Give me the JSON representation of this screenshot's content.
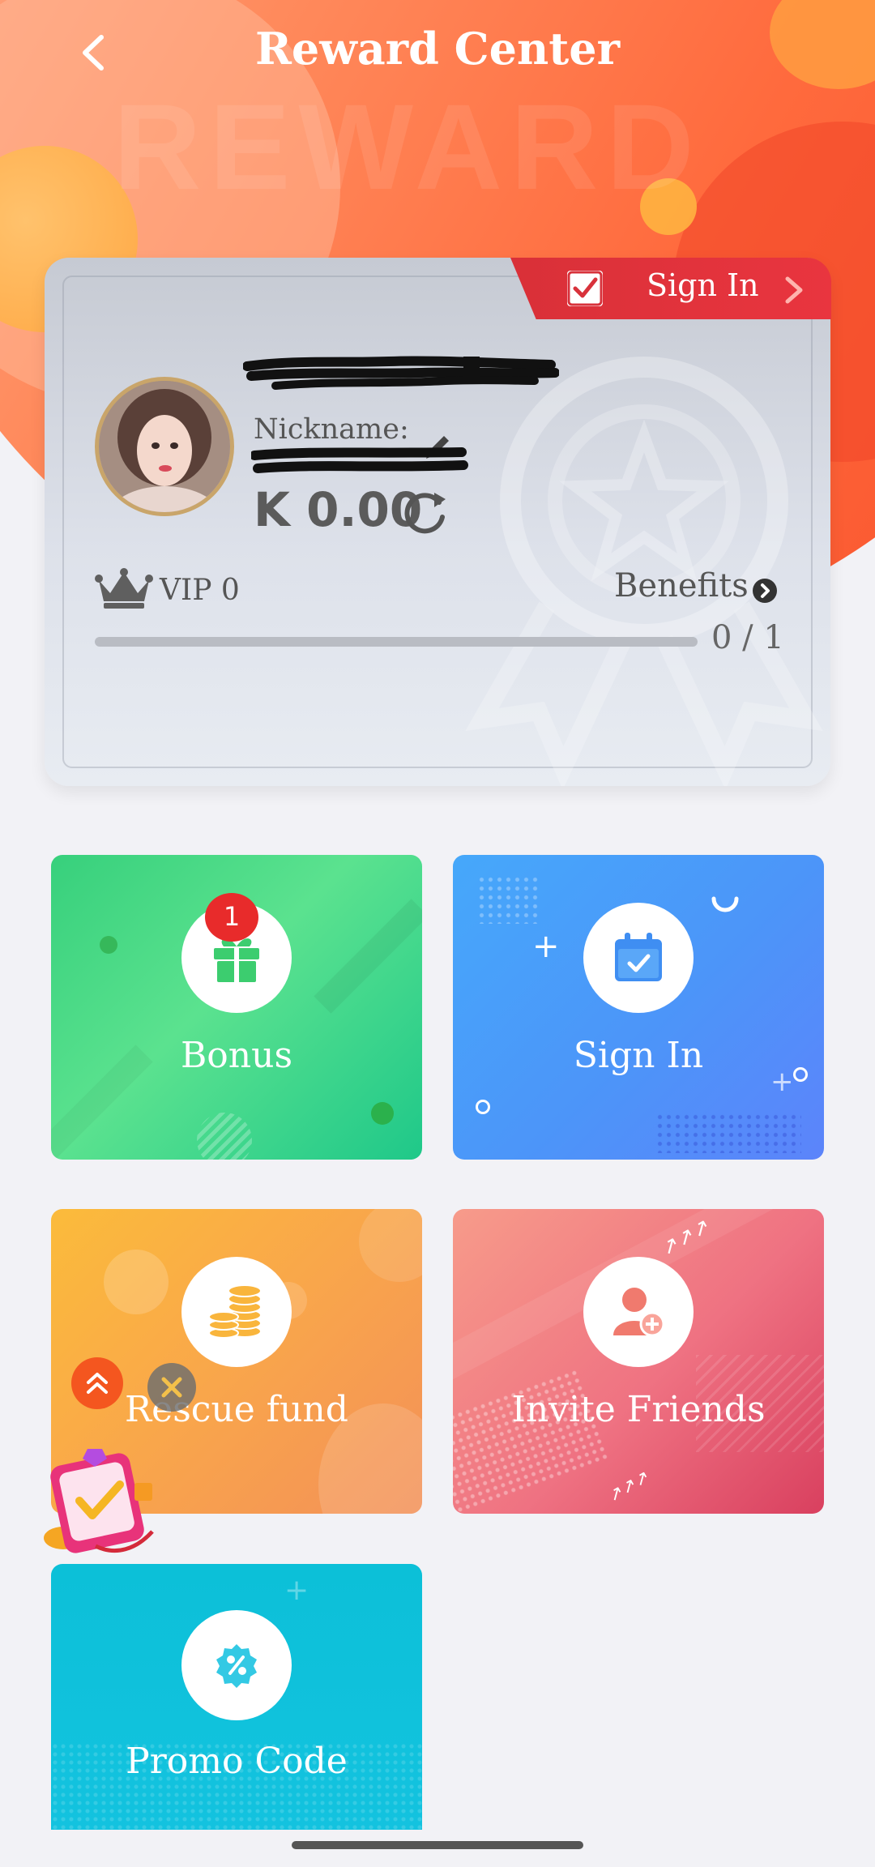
{
  "header": {
    "title": "Reward Center",
    "back_icon": "chevron-left-icon"
  },
  "profile": {
    "signin_tab_label": "Sign In",
    "nickname_label": "Nickname:",
    "balance": "K 0.00",
    "vip_label": "VIP 0",
    "benefits_label": "Benefits",
    "progress_text": "0 / 1",
    "progress_fraction": 0
  },
  "tiles": [
    {
      "label": "Bonus",
      "icon": "gift-icon",
      "badge": "1"
    },
    {
      "label": "Sign In",
      "icon": "calendar-check-icon"
    },
    {
      "label": "Rescue fund",
      "icon": "coins-icon"
    },
    {
      "label": "Invite Friends",
      "icon": "add-user-icon"
    },
    {
      "label": "Promo Code",
      "icon": "percent-icon"
    }
  ],
  "colors": {
    "header_orange": "#ff6a3d",
    "signin_red": "#e0323c",
    "bonus_green": "#37d07c",
    "signin_blue": "#4c95f9",
    "rescue_orange": "#f9a64b",
    "invite_pink": "#ef7282",
    "promo_cyan": "#0cc0d8"
  }
}
